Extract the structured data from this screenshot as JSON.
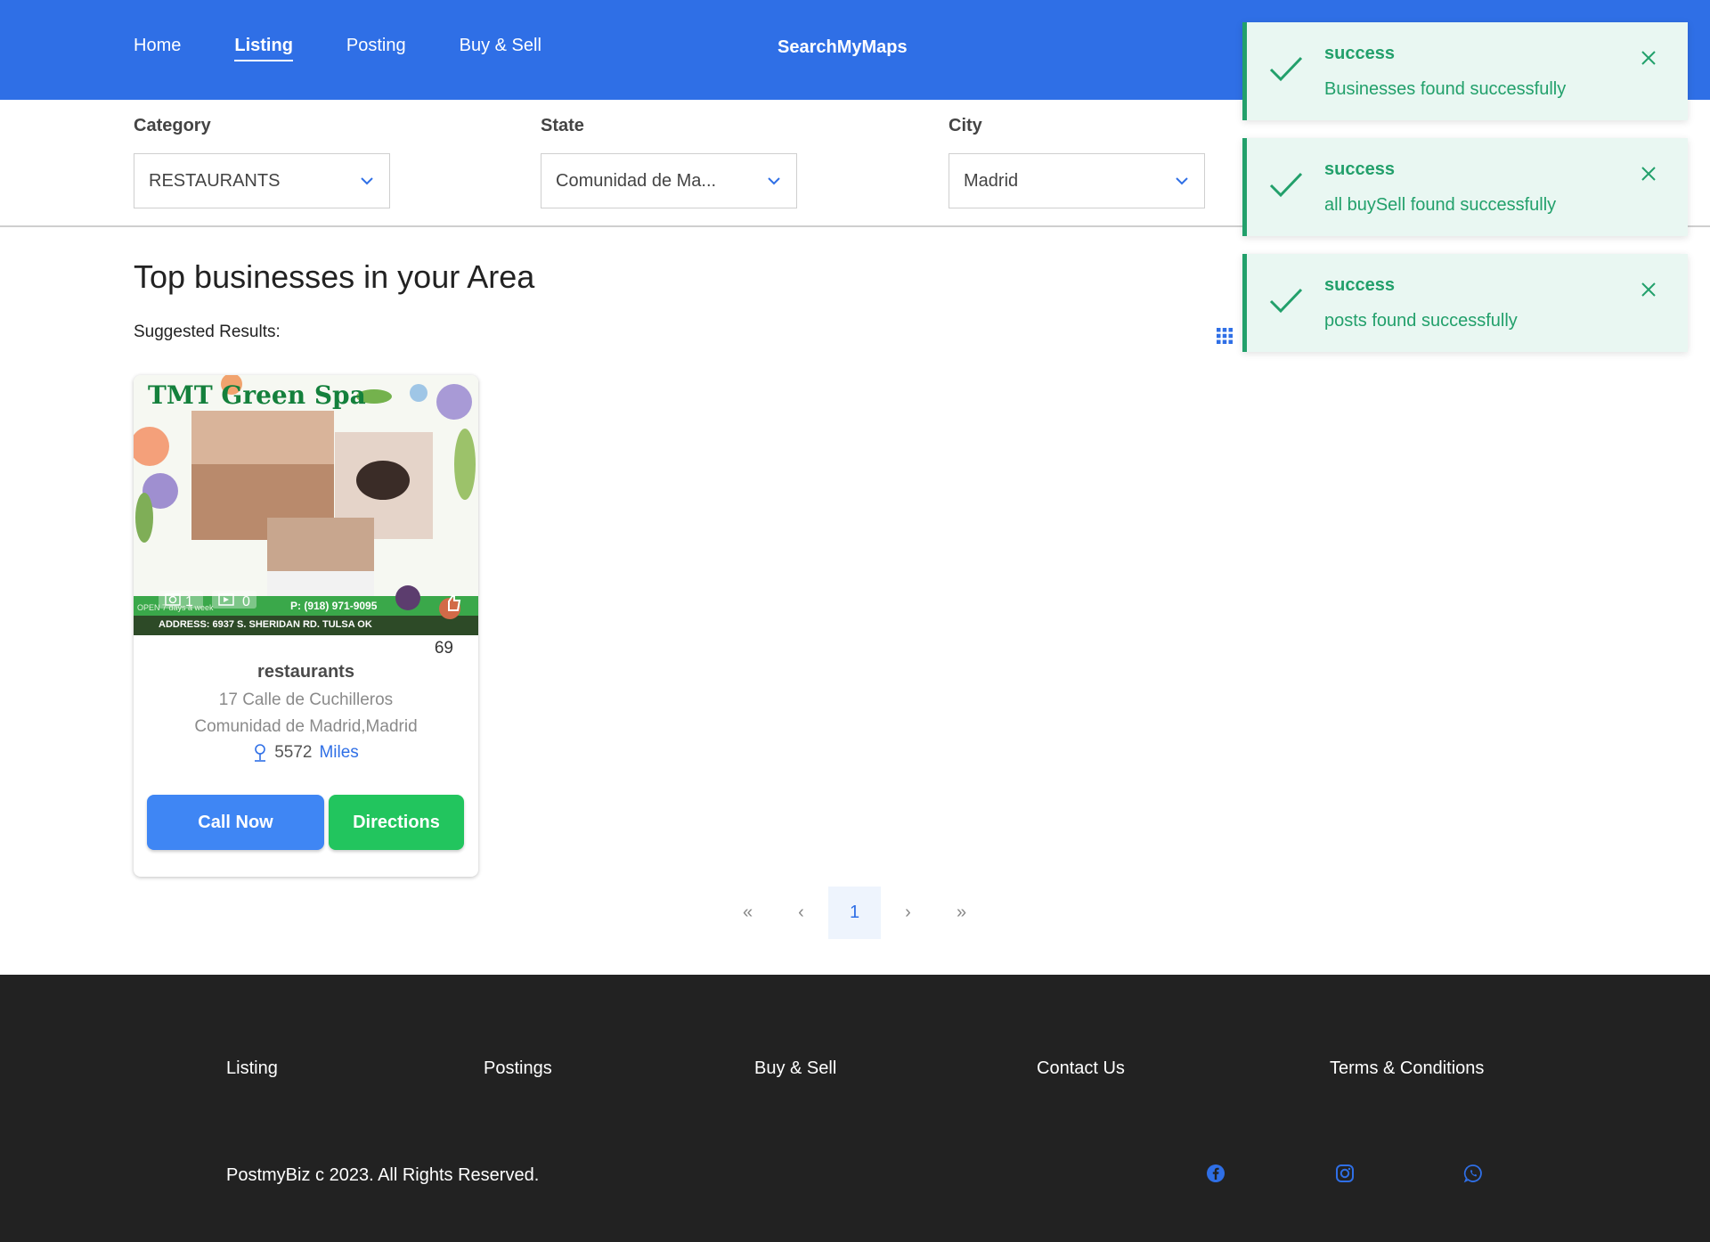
{
  "header": {
    "nav": [
      {
        "label": "Home"
      },
      {
        "label": "Listing"
      },
      {
        "label": "Posting"
      },
      {
        "label": "Buy & Sell"
      }
    ],
    "brand": "SearchMyMaps",
    "color": "#2f6fe6"
  },
  "filters": {
    "category": {
      "label": "Category",
      "value": "RESTAURANTS"
    },
    "state": {
      "label": "State",
      "value": "Comunidad de Ma..."
    },
    "city": {
      "label": "City",
      "value": "Madrid"
    }
  },
  "main": {
    "heading": "Top businesses in your Area",
    "suggested": "Suggested Results:",
    "view_icon": "grid-icon"
  },
  "card": {
    "image": {
      "title": "TMT Green Spa",
      "photos": "1",
      "videos": "0",
      "phone": "P: (918) 971-9095",
      "open": "OPEN 7 days a week",
      "address": "ADDRESS: 6937 S. SHERIDAN RD. TULSA OK"
    },
    "likes": "69",
    "category": "restaurants",
    "address": "17 Calle de Cuchilleros",
    "region": "Comunidad de Madrid,Madrid",
    "distance": "5572",
    "distance_unit": "Miles",
    "call_label": "Call Now",
    "directions_label": "Directions"
  },
  "pagination": {
    "first": "«",
    "prev": "‹",
    "current": "1",
    "next": "›",
    "last": "»"
  },
  "footer": {
    "links": [
      "Listing",
      "Postings",
      "Buy & Sell",
      "Contact Us",
      "Terms & Conditions"
    ],
    "copyright": "PostmyBiz c 2023. All Rights Reserved.",
    "social": [
      "facebook-icon",
      "instagram-icon",
      "whatsapp-icon"
    ]
  },
  "toasts": [
    {
      "title": "success",
      "message": "Businesses found successfully"
    },
    {
      "title": "success",
      "message": "all buySell found successfully"
    },
    {
      "title": "success",
      "message": "posts found successfully"
    }
  ],
  "colors": {
    "primary": "#2f6fe6",
    "call_button": "#3f86f4",
    "directions_button": "#22c55e",
    "toast_text": "#22a06b",
    "toast_bg": "#e9f7f2",
    "footer_bg": "#222222"
  }
}
